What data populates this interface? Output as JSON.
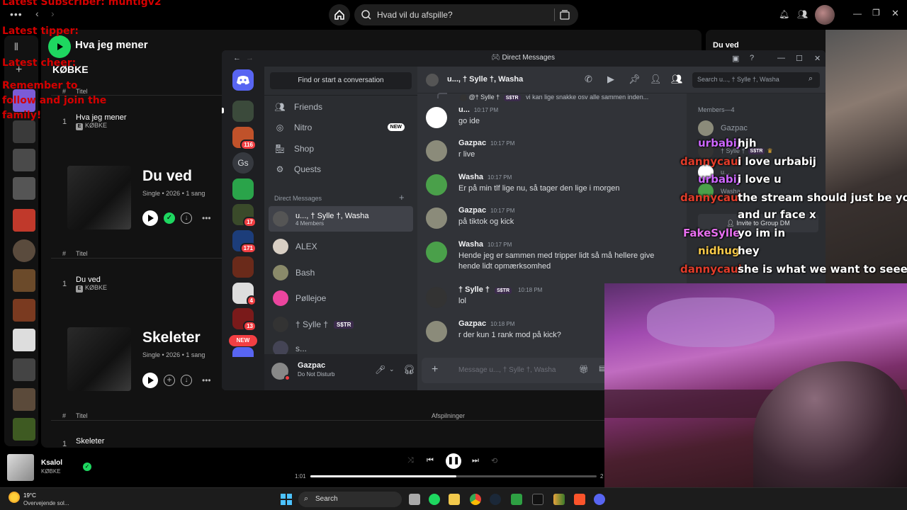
{
  "spotify": {
    "search_placeholder": "Hvad vil du afspille?",
    "playlist_title": "Hva jeg mener",
    "artist": "KØBKE",
    "sections": [
      {
        "col_header": "Titel",
        "row": {
          "index": "1",
          "title": "Hva jeg mener",
          "artist": "KØBKE"
        }
      },
      {
        "album_title": "Du ved",
        "meta": "Single • 2026 • 1 sang",
        "col_header": "Titel",
        "row": {
          "index": "1",
          "title": "Du ved",
          "artist": "KØBKE"
        }
      },
      {
        "album_title": "Skeleter",
        "meta": "Single • 2026 • 1 sang",
        "col_header": "Titel",
        "col_header_plays": "Afspilninger",
        "row": {
          "index": "1",
          "title": "Skeleter"
        }
      }
    ],
    "right_panel_title": "Du ved",
    "player": {
      "track": "Ksalol",
      "artist": "KØBKE",
      "elapsed": "1:01",
      "end_partial": "2",
      "progress": 0.51
    }
  },
  "overlay": {
    "lines": [
      "Latest Subscriber: muntigv2",
      "Latest tipper:",
      "Latest cheer:",
      "Remember to",
      "follow and join the",
      "family!"
    ]
  },
  "discord": {
    "window_title": "Direct Messages",
    "find_placeholder": "Find or start a conversation",
    "nav": [
      {
        "label": "Friends",
        "icon": "friends-icon"
      },
      {
        "label": "Nitro",
        "icon": "nitro-icon",
        "badge": "NEW"
      },
      {
        "label": "Shop",
        "icon": "shop-icon"
      },
      {
        "label": "Quests",
        "icon": "quests-icon"
      }
    ],
    "dm_header": "Direct Messages",
    "dms": [
      {
        "name": "u..., † Sylle †, Washa",
        "sub": "4 Members"
      },
      {
        "name": "ALEX"
      },
      {
        "name": "Bash"
      },
      {
        "name": "Pøllejoe"
      },
      {
        "name": "† Sylle †",
        "tag": "S$TR"
      },
      {
        "name": "s..."
      }
    ],
    "servers": [
      {
        "badge": ""
      },
      {
        "badge": "116"
      },
      {
        "label": "Gs"
      },
      {
        "badge": ""
      },
      {
        "badge": "17"
      },
      {
        "badge": "171"
      },
      {
        "badge": ""
      },
      {
        "badge": "4"
      },
      {
        "badge": "13"
      },
      {
        "label": "NEW"
      }
    ],
    "user": {
      "name": "Gazpac",
      "status": "Do Not Disturb"
    },
    "chat_title": "u..., † Sylle †, Washa",
    "search_placeholder": "Search u..., † Sylle †, Washa",
    "reply_preview": {
      "name": "@† Sylle †",
      "tag": "S$TR",
      "text": "vi kan lige snakke osv alle sammen inden..."
    },
    "messages": [
      {
        "name": "u...",
        "time": "10:17 PM",
        "text": "go ide"
      },
      {
        "name": "Gazpac",
        "time": "10:17 PM",
        "text": "r live"
      },
      {
        "name": "Washa",
        "time": "10:17 PM",
        "text": "Er på min tlf lige nu, så tager den lige i morgen"
      },
      {
        "name": "Gazpac",
        "time": "10:17 PM",
        "text": "på tiktok og kick"
      },
      {
        "name": "Washa",
        "time": "10:17 PM",
        "text": "Hende jeg er sammen med tripper lidt så må hellere give hende lidt opmærksomhed"
      },
      {
        "name": "† Sylle †",
        "tag": "S$TR",
        "time": "10:18 PM",
        "text": "lol"
      },
      {
        "name": "Gazpac",
        "time": "10:18 PM",
        "text": "r der kun 1 rank mod på kick?"
      }
    ],
    "input_placeholder": "Message u..., † Sylle †, Washa",
    "members_header": "Members—4",
    "members": [
      {
        "name": "Gazpac"
      },
      {
        "name": "† Sylle †",
        "tag": "S$TR"
      },
      {
        "name": "u..."
      },
      {
        "name": "Washa"
      }
    ],
    "invite_label": "Invite to Group DM"
  },
  "stream_chat": [
    {
      "user": "urbabij",
      "color": "#cc66ff",
      "text": "hjh"
    },
    {
      "user": "dannycaul",
      "color": "#e23c2a",
      "text": "i love urbabij"
    },
    {
      "user": "urbabij",
      "color": "#cc66ff",
      "text": "i love u"
    },
    {
      "user": "dannycaul",
      "color": "#e23c2a",
      "text": "the stream should just be you"
    },
    {
      "user": "",
      "color": "#ffffff",
      "text": "and ur face x"
    },
    {
      "user": "FakeSylle",
      "color": "#e86ff0",
      "text": "yo im in"
    },
    {
      "user": "nidhug",
      "color": "#f7c948",
      "text": "hey"
    },
    {
      "user": "dannycaul",
      "color": "#e23c2a",
      "text": "she is what we want to seeee"
    }
  ],
  "taskbar": {
    "weather_temp": "19°C",
    "weather_desc": "Overvejende sol...",
    "search_label": "Search"
  },
  "colors": {
    "spotify_green": "#1ed760",
    "discord_blurple": "#5865f2",
    "dnd_red": "#f23f43"
  }
}
